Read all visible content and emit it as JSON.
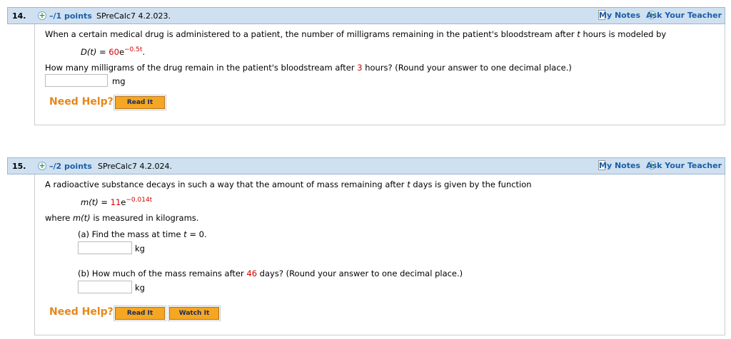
{
  "q14": {
    "number": "14.",
    "points": "–/1 points",
    "source": "SPreCalc7 4.2.023.",
    "my_notes": "My Notes",
    "ask_teacher": "Ask Your Teacher",
    "intro_a": "When a certain medical drug is administered to a patient, the number of milligrams remaining in the patient's bloodstream after ",
    "intro_var": "t",
    "intro_b": " hours is modeled by",
    "fn_name": "D(t)",
    "fn_eq": " = ",
    "fn_coef": "60",
    "fn_base": "e",
    "fn_exp": "−0.5t",
    "fn_end": ".",
    "question_a": "How many milligrams of the drug remain in the patient's bloodstream after ",
    "question_val": "3",
    "question_b": " hours? (Round your answer to one decimal place.)",
    "answer_value": "",
    "unit": "mg",
    "need_help": "Need Help?",
    "read_it": "Read It"
  },
  "q15": {
    "number": "15.",
    "points": "–/2 points",
    "source": "SPreCalc7 4.2.024.",
    "my_notes": "My Notes",
    "ask_teacher": "Ask Your Teacher",
    "intro_a": "A radioactive substance decays in such a way that the amount of mass remaining after ",
    "intro_var": "t",
    "intro_b": " days is given by the function",
    "fn_name": "m(t)",
    "fn_eq": " = ",
    "fn_coef": "11",
    "fn_base": "e",
    "fn_exp": "−0.014t",
    "where_a": "where ",
    "where_var": "m(t)",
    "where_b": " is measured in kilograms.",
    "part_a_a": "(a) Find the mass at time ",
    "part_a_var": "t",
    "part_a_b": " = 0.",
    "part_a_answer": "",
    "part_a_unit": "kg",
    "part_b_a": "(b) How much of the mass remains after ",
    "part_b_val": "46",
    "part_b_b": " days? (Round your answer to one decimal place.)",
    "part_b_answer": "",
    "part_b_unit": "kg",
    "need_help": "Need Help?",
    "read_it": "Read It",
    "watch_it": "Watch It"
  }
}
